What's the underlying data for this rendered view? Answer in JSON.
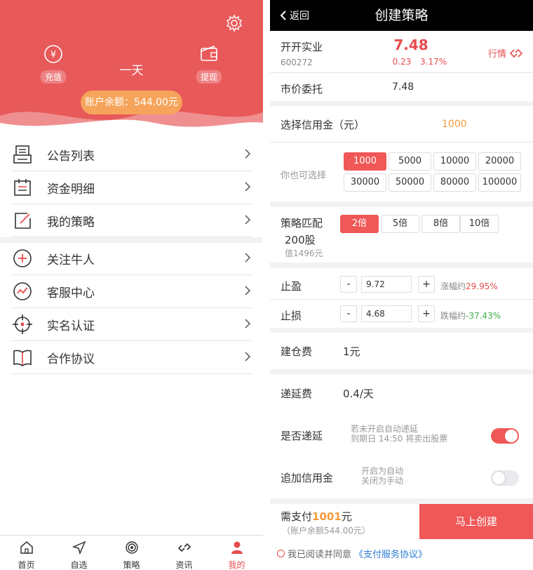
{
  "left": {
    "header": {
      "recharge_label": "充值",
      "recharge_symbol": "¥",
      "withdraw_label": "提现",
      "middle_text": "一天",
      "balance_text": "账户余额：544.00元"
    },
    "menu": [
      {
        "label": "公告列表",
        "icon": "notice-icon"
      },
      {
        "label": "资金明细",
        "icon": "calendar-icon"
      },
      {
        "label": "我的策略",
        "icon": "edit-icon"
      },
      {
        "label": "关注牛人",
        "icon": "plus-circle-icon"
      },
      {
        "label": "客服中心",
        "icon": "chart-circle-icon"
      },
      {
        "label": "实名认证",
        "icon": "target-icon"
      },
      {
        "label": "合作协议",
        "icon": "book-icon"
      }
    ],
    "tabs": [
      {
        "label": "首页",
        "icon": "home-icon",
        "active": false
      },
      {
        "label": "自选",
        "icon": "send-icon",
        "active": false
      },
      {
        "label": "策略",
        "icon": "radar-icon",
        "active": false
      },
      {
        "label": "资讯",
        "icon": "link-icon",
        "active": false
      },
      {
        "label": "我的",
        "icon": "user-icon",
        "active": true
      }
    ]
  },
  "right": {
    "topbar": {
      "back_label": "返回",
      "title": "创建策略"
    },
    "stock": {
      "name": "开开实业",
      "code": "600272",
      "price": "7.48",
      "change": "0.23",
      "change_pct": "3.17%",
      "quote_label": "行情"
    },
    "market_order": {
      "label": "市价委托",
      "value": "7.48"
    },
    "credit": {
      "label": "选择信用金（元）",
      "value": "1000"
    },
    "options": {
      "label": "你也可选择",
      "amounts": [
        "1000",
        "5000",
        "10000",
        "20000",
        "30000",
        "50000",
        "80000",
        "100000"
      ],
      "selected": "1000"
    },
    "match": {
      "label": "策略匹配",
      "shares": "200股",
      "worth": "值1496元",
      "multipliers": [
        "2倍",
        "5倍",
        "8倍",
        "10倍"
      ],
      "selected": "2倍"
    },
    "take_profit": {
      "label": "止盈",
      "minus": "-",
      "plus": "+",
      "value": "9.72",
      "note_prefix": "涨幅约",
      "note_value": "29.95%"
    },
    "stop_loss": {
      "label": "止损",
      "minus": "-",
      "plus": "+",
      "value": "4.68",
      "note_prefix": "跌幅约",
      "note_value": "-37.43%"
    },
    "open_fee": {
      "label": "建仓费",
      "value": "1元"
    },
    "defer_fee": {
      "label": "递延费",
      "value": "0.4/天"
    },
    "defer": {
      "label": "是否递延",
      "hint1": "若未开启自动递延",
      "hint2": "到期日 14:50 将卖出股票",
      "on": true
    },
    "add_credit": {
      "label": "追加信用金",
      "hint1": "开启为自动",
      "hint2": "关闭为手动",
      "on": false
    },
    "pay": {
      "prefix": "需支付",
      "amount": "1001",
      "suffix": "元",
      "sub": "（账户余额544.00元）",
      "button": "马上创建"
    },
    "agreement": {
      "text": "我已阅读并同意",
      "link": "《支付服务协议》"
    },
    "colors": {
      "accent": "#f05757",
      "green": "#3cb04a",
      "orange": "#f39a3a"
    }
  }
}
